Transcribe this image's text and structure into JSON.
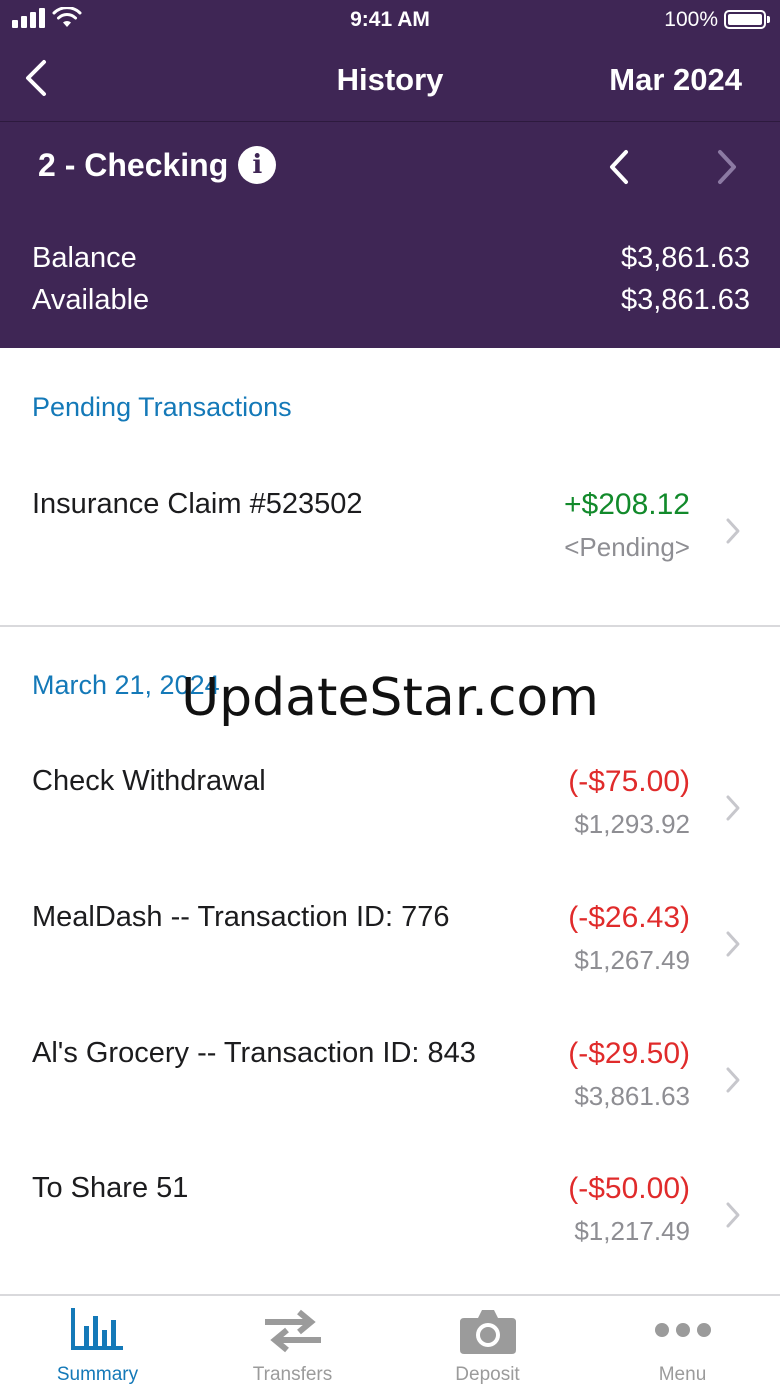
{
  "status_bar": {
    "time": "9:41 AM",
    "battery": "100%"
  },
  "nav": {
    "title": "History",
    "period": "Mar 2024"
  },
  "account": {
    "name": "2 - Checking",
    "balance_label": "Balance",
    "balance_value": "$3,861.63",
    "available_label": "Available",
    "available_value": "$3,861.63"
  },
  "pending": {
    "title": "Pending Transactions",
    "items": [
      {
        "description": "Insurance Claim #523502",
        "amount": "+$208.12",
        "status": "<Pending>"
      }
    ]
  },
  "history": {
    "date": "March 21, 2024",
    "items": [
      {
        "description": "Check Withdrawal",
        "amount": "(-$75.00)",
        "balance": "$1,293.92"
      },
      {
        "description": "MealDash -- Transaction ID: 776",
        "amount": "(-$26.43)",
        "balance": "$1,267.49"
      },
      {
        "description": "Al's Grocery -- Transaction ID: 843",
        "amount": "(-$29.50)",
        "balance": "$3,861.63"
      },
      {
        "description": "To Share 51",
        "amount": "(-$50.00)",
        "balance": "$1,217.49"
      }
    ]
  },
  "watermark": "UpdateStar.com",
  "tabs": [
    {
      "label": "Summary",
      "icon": "bar-chart-icon",
      "active": true
    },
    {
      "label": "Transfers",
      "icon": "transfer-arrows-icon",
      "active": false
    },
    {
      "label": "Deposit",
      "icon": "camera-icon",
      "active": false
    },
    {
      "label": "Menu",
      "icon": "more-dots-icon",
      "active": false
    }
  ],
  "colors": {
    "header": "#3f2655",
    "accent": "#1479b8",
    "positive": "#128a2b",
    "negative": "#e02b2b"
  }
}
